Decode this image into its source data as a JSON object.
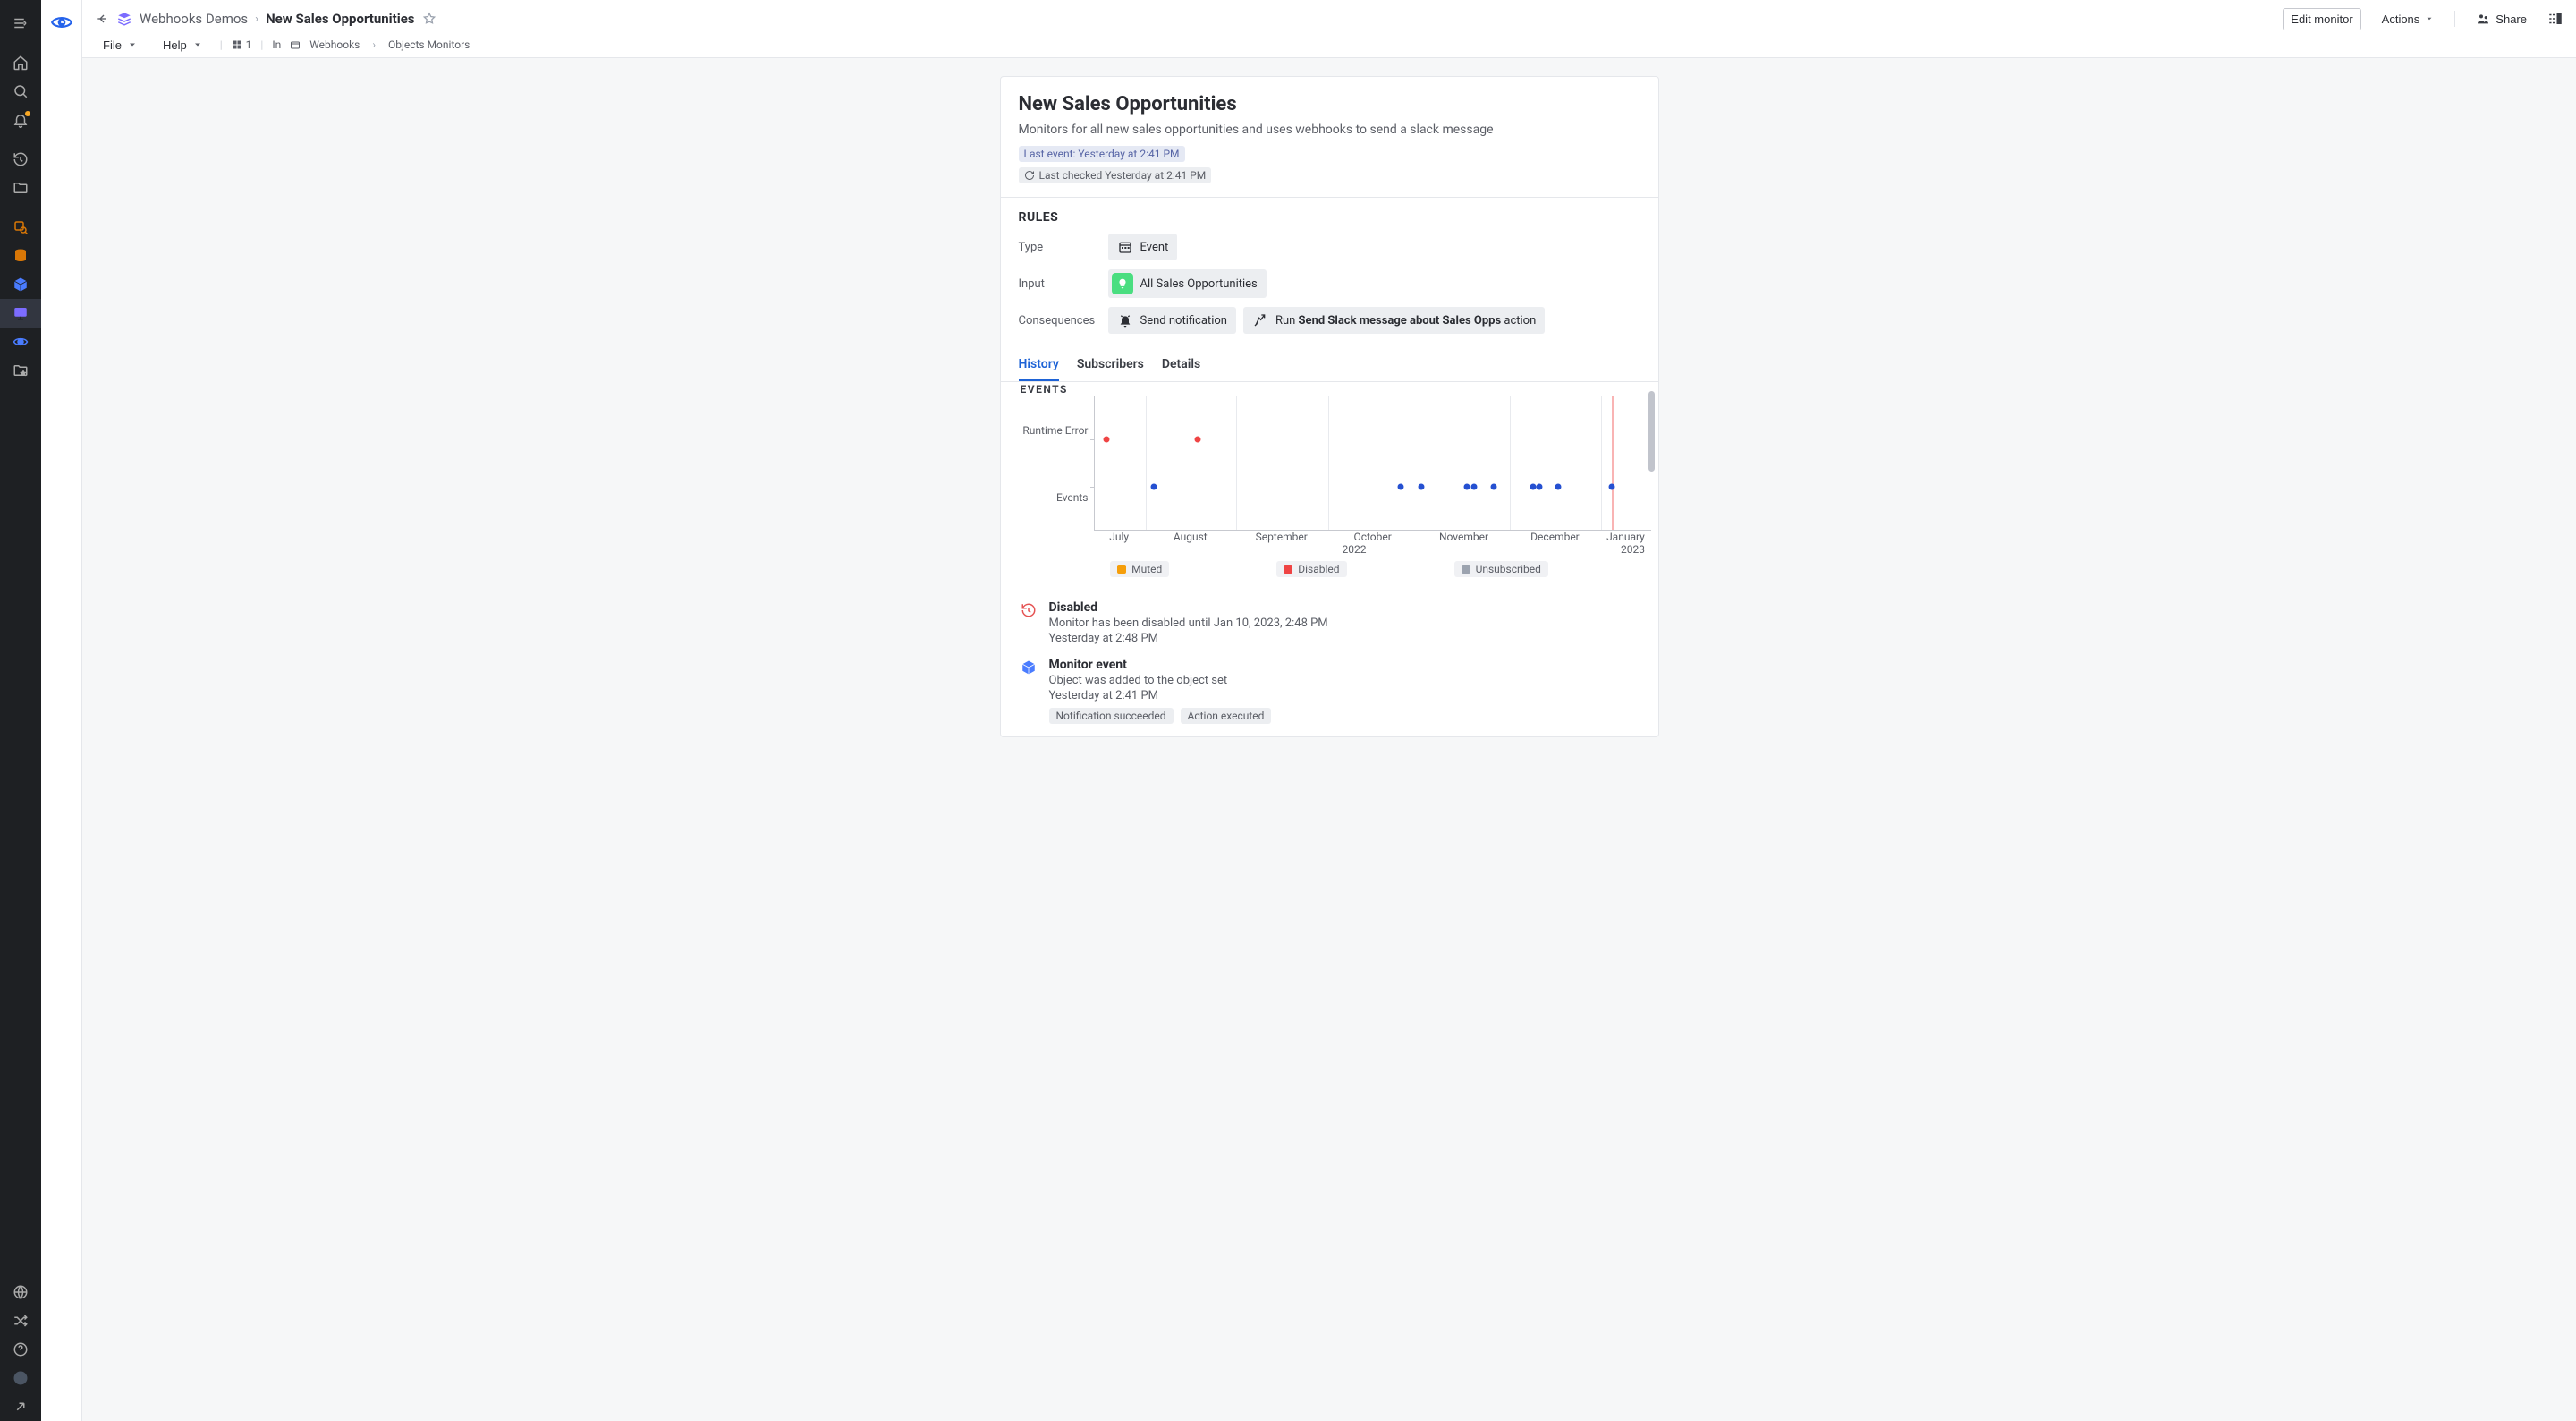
{
  "breadcrumb": {
    "folder": "Webhooks Demos",
    "current": "New Sales Opportunities"
  },
  "header": {
    "file_menu": "File",
    "help_menu": "Help",
    "viewers": "1",
    "in_label": "In",
    "path": [
      "Webhooks",
      "Objects Monitors"
    ],
    "edit_button": "Edit monitor",
    "actions_button": "Actions",
    "share_button": "Share"
  },
  "monitor": {
    "title": "New Sales Opportunities",
    "description": "Monitors for all new sales opportunities and uses webhooks to send a slack message",
    "last_event": "Last event: Yesterday at 2:41 PM",
    "last_checked": "Last checked Yesterday at 2:41 PM"
  },
  "rules": {
    "heading": "RULES",
    "type_label": "Type",
    "type_value": "Event",
    "input_label": "Input",
    "input_value": "All Sales Opportunities",
    "consequences_label": "Consequences",
    "send_notification": "Send notification",
    "run_prefix": "Run ",
    "run_action": "Send Slack message about Sales Opps",
    "run_suffix": " action"
  },
  "tabs": {
    "history": "History",
    "subscribers": "Subscribers",
    "details": "Details"
  },
  "chart": {
    "events_title": "EVENTS",
    "ycategories": [
      "Runtime Error",
      "Events"
    ],
    "xcategories": [
      "July",
      "August",
      "September",
      "October",
      "November",
      "December",
      "January"
    ],
    "year1": "2022",
    "year2": "2023",
    "legend": {
      "muted": "Muted",
      "disabled": "Disabled",
      "unsubscribed": "Unsubscribed"
    }
  },
  "chart_data": {
    "type": "scatter",
    "y_categories": [
      "Runtime Error",
      "Events"
    ],
    "x_range_months": [
      "2022-07",
      "2022-08",
      "2022-09",
      "2022-10",
      "2022-11",
      "2022-12",
      "2023-01"
    ],
    "now_marker": "2023-01-05",
    "series": [
      {
        "name": "Runtime Error",
        "color": "#ef4444",
        "points": [
          "2022-07-08",
          "2022-08-08"
        ]
      },
      {
        "name": "Events",
        "color": "#2550d1",
        "points": [
          "2022-07-22",
          "2022-10-15",
          "2022-10-23",
          "2022-11-10",
          "2022-11-12",
          "2022-11-18",
          "2022-12-05",
          "2022-12-07",
          "2022-12-15",
          "2023-01-04"
        ]
      }
    ],
    "legend": [
      {
        "label": "Muted",
        "color": "#f59e0b"
      },
      {
        "label": "Disabled",
        "color": "#ef4444"
      },
      {
        "label": "Unsubscribed",
        "color": "#9ca3af"
      }
    ]
  },
  "feed": [
    {
      "icon": "history-red",
      "title": "Disabled",
      "desc": "Monitor has been disabled until Jan 10, 2023, 2:48 PM",
      "time": "Yesterday at 2:48 PM",
      "badges": []
    },
    {
      "icon": "cube-blue",
      "title": "Monitor event",
      "desc": "Object was added to the object set",
      "time": "Yesterday at 2:41 PM",
      "badges": [
        "Notification succeeded",
        "Action executed"
      ]
    }
  ]
}
